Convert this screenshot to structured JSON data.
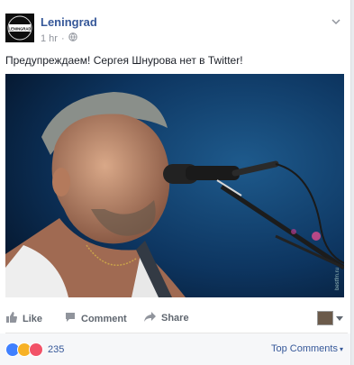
{
  "post": {
    "page_name": "Leningrad",
    "timestamp": "1 hr",
    "avatar_text": "LENINGRAD",
    "text": "Предупреждаем! Сергея Шнурова нет в Twitter!",
    "photo_watermark": "bestfm.ru"
  },
  "actions": {
    "like": "Like",
    "comment": "Comment",
    "share": "Share"
  },
  "footer": {
    "reaction_count": "235",
    "sort_label": "Top Comments"
  },
  "colors": {
    "link": "#365899",
    "muted": "#90949c",
    "like_blue": "#4080ff",
    "haha_yellow": "#f7b125",
    "love_red": "#f25268"
  }
}
